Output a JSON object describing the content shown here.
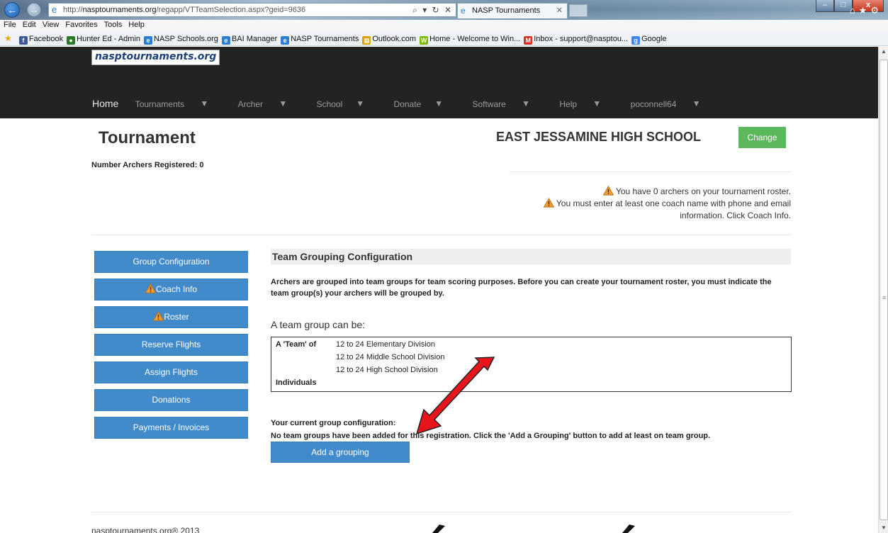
{
  "browser": {
    "url_prefix": "http://",
    "url_host": "nasptournaments.org",
    "url_path": "/regapp/VTTeamSelection.aspx?geid=9636",
    "address_controls": "⌕ ▾ ↻ ✕",
    "tab_title": "NASP Tournaments",
    "menu": [
      "File",
      "Edit",
      "View",
      "Favorites",
      "Tools",
      "Help"
    ],
    "favorites": [
      {
        "label": "Facebook",
        "icon": "facebook-icon",
        "color": "#3b5998",
        "glyph": "f"
      },
      {
        "label": "Hunter Ed - Admin",
        "icon": "globe-icon",
        "color": "#2a7a2a",
        "glyph": "●"
      },
      {
        "label": "NASP Schools.org",
        "icon": "ie-page-icon",
        "color": "#2a7fd4",
        "glyph": "e"
      },
      {
        "label": "BAI Manager",
        "icon": "ie-page-icon",
        "color": "#2a7fd4",
        "glyph": "e"
      },
      {
        "label": "NASP Tournaments",
        "icon": "ie-page-icon",
        "color": "#2a7fd4",
        "glyph": "e"
      },
      {
        "label": "Outlook.com",
        "icon": "windows-icon",
        "color": "#e0a000",
        "glyph": "▦"
      },
      {
        "label": "Home - Welcome to Win...",
        "icon": "app-icon",
        "color": "#7ab800",
        "glyph": "W"
      },
      {
        "label": "Inbox - support@nasptou...",
        "icon": "gmail-icon",
        "color": "#d93025",
        "glyph": "M"
      },
      {
        "label": "Google",
        "icon": "google-icon",
        "color": "#4285f4",
        "glyph": "g"
      }
    ]
  },
  "site": {
    "brand": "nasptournaments.org",
    "nav": [
      "Home",
      "Tournaments",
      "Archer",
      "School",
      "Donate",
      "Software",
      "Help",
      "poconnell64"
    ]
  },
  "page": {
    "title": "Tournament",
    "archers_registered": "Number Archers Registered: 0",
    "school_name": "EAST JESSAMINE HIGH SCHOOL",
    "change_button": "Change",
    "warning_1": "You have 0 archers on your tournament roster.",
    "warning_2_line1": "You must enter at least one coach name with phone and email",
    "warning_2_line2": "information. Click Coach Info."
  },
  "sidebar": {
    "items": [
      {
        "label": "Group Configuration",
        "warn": false
      },
      {
        "label": "Coach Info",
        "warn": true
      },
      {
        "label": "Roster",
        "warn": true
      },
      {
        "label": "Reserve Flights",
        "warn": false
      },
      {
        "label": "Assign Flights",
        "warn": false
      },
      {
        "label": "Donations",
        "warn": false
      },
      {
        "label": "Payments / Invoices",
        "warn": false
      }
    ]
  },
  "main": {
    "section_title": "Team Grouping Configuration",
    "intro": "Archers are grouped into team groups for team scoring purposes. Before you can create your tournament roster, you must indicate the team group(s) your archers will be grouped by.",
    "can_be": "A team group can be:",
    "team_label": "A 'Team' of",
    "team_options": [
      "12 to 24 Elementary Division",
      "12 to 24 Middle School Division",
      "12 to 24 High School Division"
    ],
    "individuals_label": "Individuals",
    "current_config_label": "Your current group configuration:",
    "no_groups_message": "No team groups have been added for this registration. Click the 'Add a Grouping' button to add at least on team group.",
    "add_button": "Add a grouping"
  },
  "footer": {
    "copyright": "nasptournaments.org® 2013"
  },
  "colors": {
    "nav_bg": "#232323",
    "primary_button": "#428bca",
    "success_button": "#5cb85c",
    "warning_orange": "#f0a030",
    "annotation_arrow": "#e8141b"
  }
}
